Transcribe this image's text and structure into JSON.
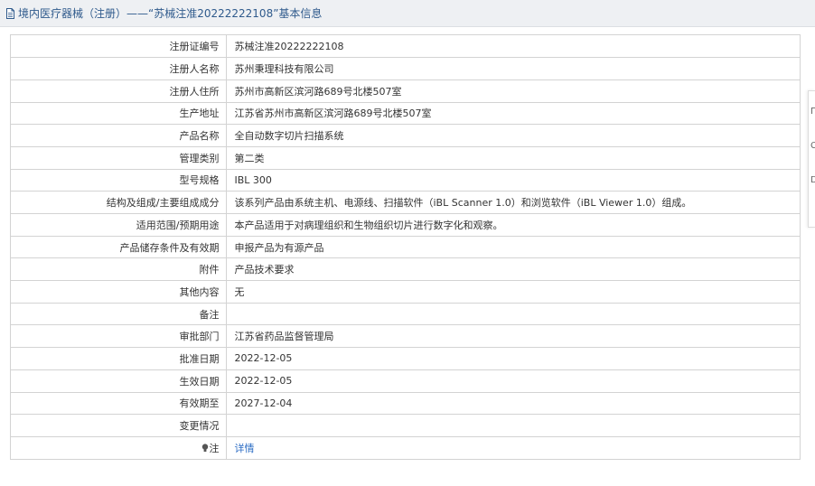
{
  "header": {
    "title": "境内医疗器械（注册）——“苏械注准20222222108”基本信息"
  },
  "rows": [
    {
      "label": "注册证编号",
      "value": "苏械注准20222222108"
    },
    {
      "label": "注册人名称",
      "value": "苏州秉理科技有限公司"
    },
    {
      "label": "注册人住所",
      "value": "苏州市高新区滨河路689号北楼507室"
    },
    {
      "label": "生产地址",
      "value": "江苏省苏州市高新区滨河路689号北楼507室"
    },
    {
      "label": "产品名称",
      "value": "全自动数字切片扫描系统"
    },
    {
      "label": "管理类别",
      "value": "第二类"
    },
    {
      "label": "型号规格",
      "value": "IBL 300"
    },
    {
      "label": "结构及组成/主要组成成分",
      "value": "该系列产品由系统主机、电源线、扫描软件（iBL Scanner 1.0）和浏览软件（iBL Viewer 1.0）组成。"
    },
    {
      "label": "适用范围/预期用途",
      "value": "本产品适用于对病理组织和生物组织切片进行数字化和观察。"
    },
    {
      "label": "产品储存条件及有效期",
      "value": "申报产品为有源产品"
    },
    {
      "label": "附件",
      "value": "产品技术要求"
    },
    {
      "label": "其他内容",
      "value": "无"
    },
    {
      "label": "备注",
      "value": ""
    },
    {
      "label": "审批部门",
      "value": "江苏省药品监督管理局"
    },
    {
      "label": "批准日期",
      "value": "2022-12-05"
    },
    {
      "label": "生效日期",
      "value": "2022-12-05"
    },
    {
      "label": "有效期至",
      "value": "2027-12-04"
    },
    {
      "label": "变更情况",
      "value": ""
    }
  ],
  "note_row": {
    "label": "注",
    "link": "详情"
  },
  "side_strip": {
    "chars": [
      "Γ",
      "C",
      "D"
    ]
  },
  "icons": {
    "title": "document-icon",
    "note": "lightbulb-icon"
  },
  "colors": {
    "title_text": "#2f5a8c",
    "link": "#2b6cc4",
    "border": "#d3d3d3",
    "title_bg": "#eef0f3"
  }
}
